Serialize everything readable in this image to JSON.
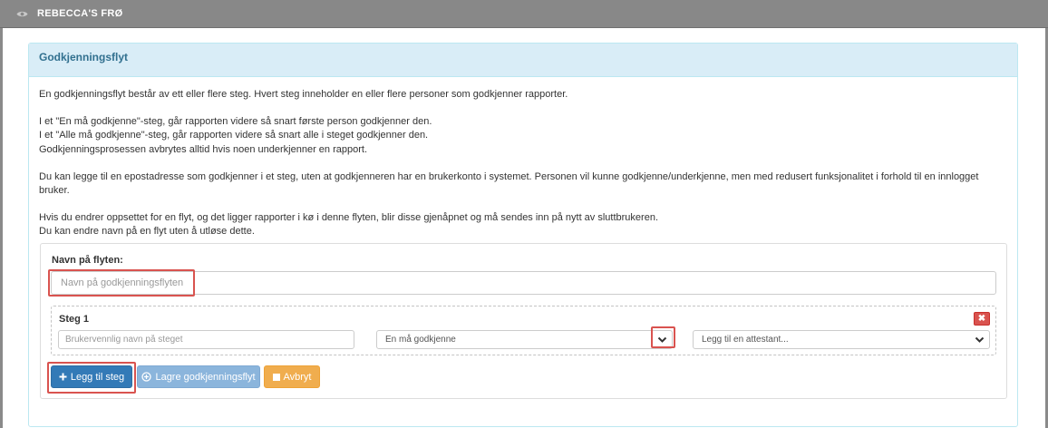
{
  "topbar": {
    "title": "REBECCA'S FRØ",
    "icon": "eye-icon"
  },
  "panel": {
    "heading": "Godkjenningsflyt",
    "intro": {
      "p1": "En godkjenningsflyt består av ett eller flere steg. Hvert steg inneholder en eller flere personer som godkjenner rapporter.",
      "p2a": "I et \"En må godkjenne\"-steg, går rapporten videre så snart første person godkjenner den.",
      "p2b": "I et \"Alle må godkjenne\"-steg, går rapporten videre så snart alle i steget godkjenner den.",
      "p2c": "Godkjenningsprosessen avbrytes alltid hvis noen underkjenner en rapport.",
      "p3": "Du kan legge til en epostadresse som godkjenner i et steg, uten at godkjenneren har en brukerkonto i systemet. Personen vil kunne godkjenne/underkjenne, men med redusert funksjonalitet i forhold til en innlogget bruker.",
      "p4a": "Hvis du endrer oppsettet for en flyt, og det ligger rapporter i kø i denne flyten, blir disse gjenåpnet og må sendes inn på nytt av sluttbrukeren.",
      "p4b": "Du kan endre navn på en flyt uten å utløse dette."
    }
  },
  "form": {
    "flow_name_label": "Navn på flyten:",
    "flow_name_placeholder": "Navn på godkjenningsflyten",
    "flow_name_value": "",
    "step": {
      "title": "Steg 1",
      "name_placeholder": "Brukervennlig navn på steget",
      "type_selected": "En må godkjenne",
      "attestant_selected": "Legg til en attestant..."
    },
    "buttons": {
      "add_step": "Legg til steg",
      "save": "Lagre godkjenningsflyt",
      "cancel": "Avbryt"
    }
  },
  "colors": {
    "topbar": "#888888",
    "panel_heading_bg": "#d9edf7",
    "panel_heading_text": "#31708f",
    "primary": "#337ab7",
    "primary_light": "#8bb5dc",
    "warning": "#f0ad4e",
    "danger": "#d9534f",
    "highlight": "#d9534f"
  }
}
